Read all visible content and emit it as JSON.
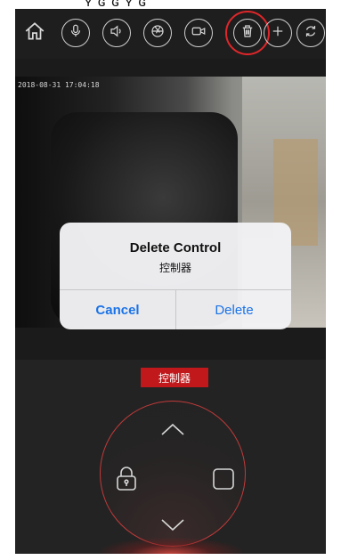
{
  "status_bar": {
    "glyphs": "ʏ ɢ ɢ ʏ ɢ"
  },
  "video": {
    "timestamp": "2018-08-31 17:04:18"
  },
  "dialog": {
    "title": "Delete Control",
    "message": "控制器",
    "cancel_label": "Cancel",
    "delete_label": "Delete"
  },
  "control_panel": {
    "label": "控制器"
  },
  "colors": {
    "accent_red": "#e0262a",
    "ios_blue": "#1a73e8",
    "background": "#1b1b1b"
  },
  "icons": {
    "toolbar": [
      "home-icon",
      "microphone-icon",
      "speaker-icon",
      "capture-icon",
      "record-icon",
      "delete-icon",
      "add-icon",
      "refresh-icon"
    ],
    "pad": [
      "up-arrow-icon",
      "lock-icon",
      "stop-icon",
      "down-arrow-icon"
    ]
  }
}
